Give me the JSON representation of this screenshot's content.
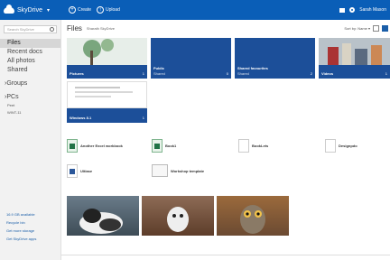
{
  "app": {
    "brand": "SkyDrive",
    "menu_caret": "▾"
  },
  "topbar": {
    "create_label": "Create",
    "upload_label": "Upload",
    "user_label": "Sarah Mason"
  },
  "sidebar": {
    "search_placeholder": "Search SkyDrive",
    "items": [
      {
        "label": "Files",
        "active": true
      },
      {
        "label": "Recent docs"
      },
      {
        "label": "All photos"
      },
      {
        "label": "Shared"
      }
    ],
    "groups_label": "Groups",
    "pcs_label": "PCs",
    "pcs": [
      "Peet",
      "WINT-11"
    ],
    "footer": [
      "16.9 GB available",
      "Recycle bin",
      "Get more storage",
      "Get SkyDrive apps"
    ]
  },
  "main": {
    "title": "Files",
    "subtitle": "Sharath SkyDrive",
    "sort_label": "Sort by: Name ▾",
    "folders": [
      {
        "name": "Pictures",
        "count": "1"
      },
      {
        "name": "Public",
        "sub": "Shared",
        "count": "0"
      },
      {
        "name": "Shared favourites",
        "sub": "Shared",
        "count": "2"
      },
      {
        "name": "Videos",
        "count": "1"
      },
      {
        "name": "Windows 8.1",
        "count": "1"
      }
    ],
    "files": [
      {
        "name": "Another Excel workbook",
        "type": "xls"
      },
      {
        "name": "Book1",
        "type": "xls"
      },
      {
        "name": "BookLets",
        "type": "blank"
      },
      {
        "name": "Designpdo",
        "type": "blank"
      },
      {
        "name": "Ultlase",
        "type": "doc"
      },
      {
        "name": "Workshop template",
        "type": "thumb"
      }
    ]
  },
  "colors": {
    "accent": "#0a5eb7",
    "tile": "#1c4f99"
  }
}
